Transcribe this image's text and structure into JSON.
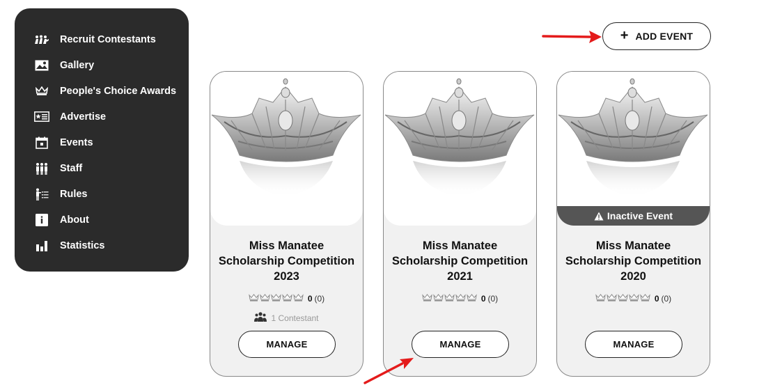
{
  "sidebar": {
    "items": [
      {
        "label": "Recruit Contestants",
        "icon": "recruit-icon"
      },
      {
        "label": "Gallery",
        "icon": "gallery-icon"
      },
      {
        "label": "People's Choice Awards",
        "icon": "crown-icon"
      },
      {
        "label": "Advertise",
        "icon": "advertise-icon"
      },
      {
        "label": "Events",
        "icon": "calendar-icon"
      },
      {
        "label": "Staff",
        "icon": "staff-icon"
      },
      {
        "label": "Rules",
        "icon": "rules-icon"
      },
      {
        "label": "About",
        "icon": "info-icon"
      },
      {
        "label": "Statistics",
        "icon": "bar-chart-icon"
      }
    ]
  },
  "toolbar": {
    "add_event_label": "ADD EVENT",
    "add_icon": "plus-icon"
  },
  "events": [
    {
      "title": "Miss Manatee Scholarship Competition 2023",
      "rating": "0",
      "rating_count": "(0)",
      "contestants": "1 Contestant",
      "manage_label": "MANAGE",
      "inactive": ""
    },
    {
      "title": "Miss Manatee Scholarship Competition 2021",
      "rating": "0",
      "rating_count": "(0)",
      "contestants": "",
      "manage_label": "MANAGE",
      "inactive": ""
    },
    {
      "title": "Miss Manatee Scholarship Competition 2020",
      "rating": "0",
      "rating_count": "(0)",
      "contestants": "",
      "manage_label": "MANAGE",
      "inactive": "Inactive Event"
    }
  ],
  "colors": {
    "sidebar_bg": "#2b2b2b",
    "annotation_arrow": "#e41b1b",
    "inactive_bar": "#555555"
  }
}
